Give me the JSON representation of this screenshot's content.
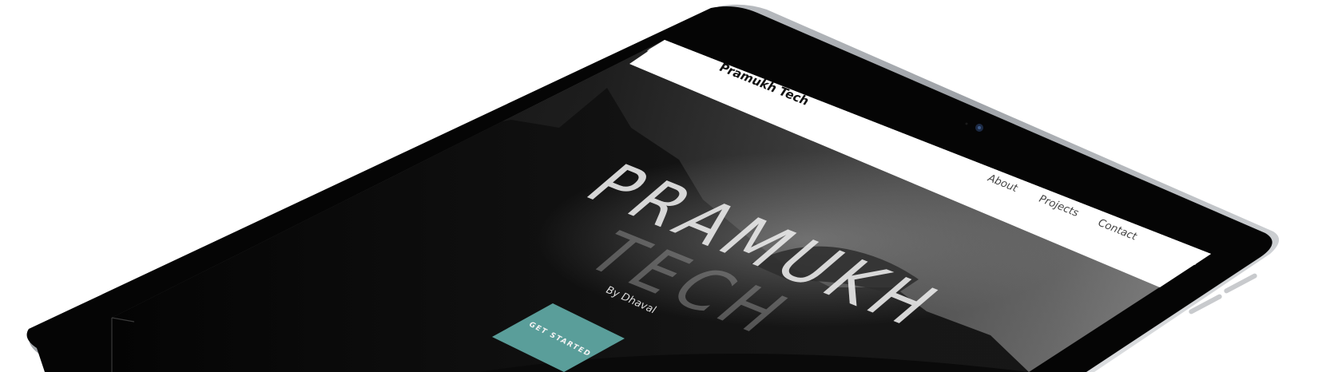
{
  "site": {
    "brand": "Pramukh Tech",
    "nav": [
      {
        "label": "About"
      },
      {
        "label": "Projects"
      },
      {
        "label": "Contact"
      }
    ]
  },
  "hero": {
    "title_line1": "PRAMUKH",
    "title_line2": "TECH",
    "subtitle": "By Dhaval",
    "cta_label": "GET STARTED"
  },
  "colors": {
    "cta": "#5a9e9a",
    "device_frame": "#050505",
    "device_edge": "#b9bcc0",
    "navbar": "#ffffff"
  }
}
